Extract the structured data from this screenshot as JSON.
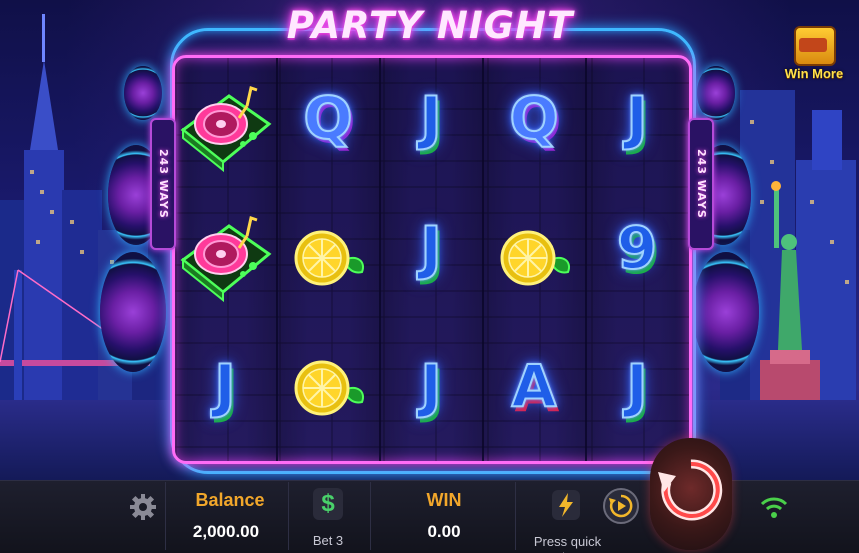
{
  "game": {
    "title": "PARTY NIGHT",
    "ways_label": "243 WAYS",
    "win_more_label": "Win More"
  },
  "reels": [
    [
      "turntable-symbol",
      "turntable-symbol",
      "J"
    ],
    [
      "Q",
      "lemon-symbol",
      "lemon-symbol"
    ],
    [
      "J",
      "J",
      "J"
    ],
    [
      "Q",
      "lemon-symbol",
      "A"
    ],
    [
      "J",
      "9",
      "J"
    ]
  ],
  "symbol_text": {
    "r1c0": "Q",
    "r2c0": "J",
    "r2c1": "J",
    "r2c2": "J",
    "r3c0": "Q",
    "r3c2": "A",
    "r4c0": "J",
    "r4c1": "9",
    "r4c2": "J",
    "r0c2": "J"
  },
  "bottom_bar": {
    "balance_label": "Balance",
    "balance_value": "2,000.00",
    "bet_label": "Bet 3",
    "win_label": "WIN",
    "win_value": "0.00",
    "quick_stop_label": "Press quick stop"
  },
  "icons": {
    "settings": "gear-icon",
    "bet": "dollar-icon",
    "quick_stop": "lightning-icon",
    "autoplay": "autoplay-icon",
    "spin": "spin-icon",
    "connection": "wifi-icon"
  },
  "colors": {
    "title_glow": "#ff4cf0",
    "frame_blue": "#3fb8ff",
    "frame_pink": "#ff6cf6",
    "balance_label": "#f2a72b",
    "win_label": "#f2a72b",
    "dollar_green": "#49d16a",
    "wifi_green": "#4ad04a"
  }
}
